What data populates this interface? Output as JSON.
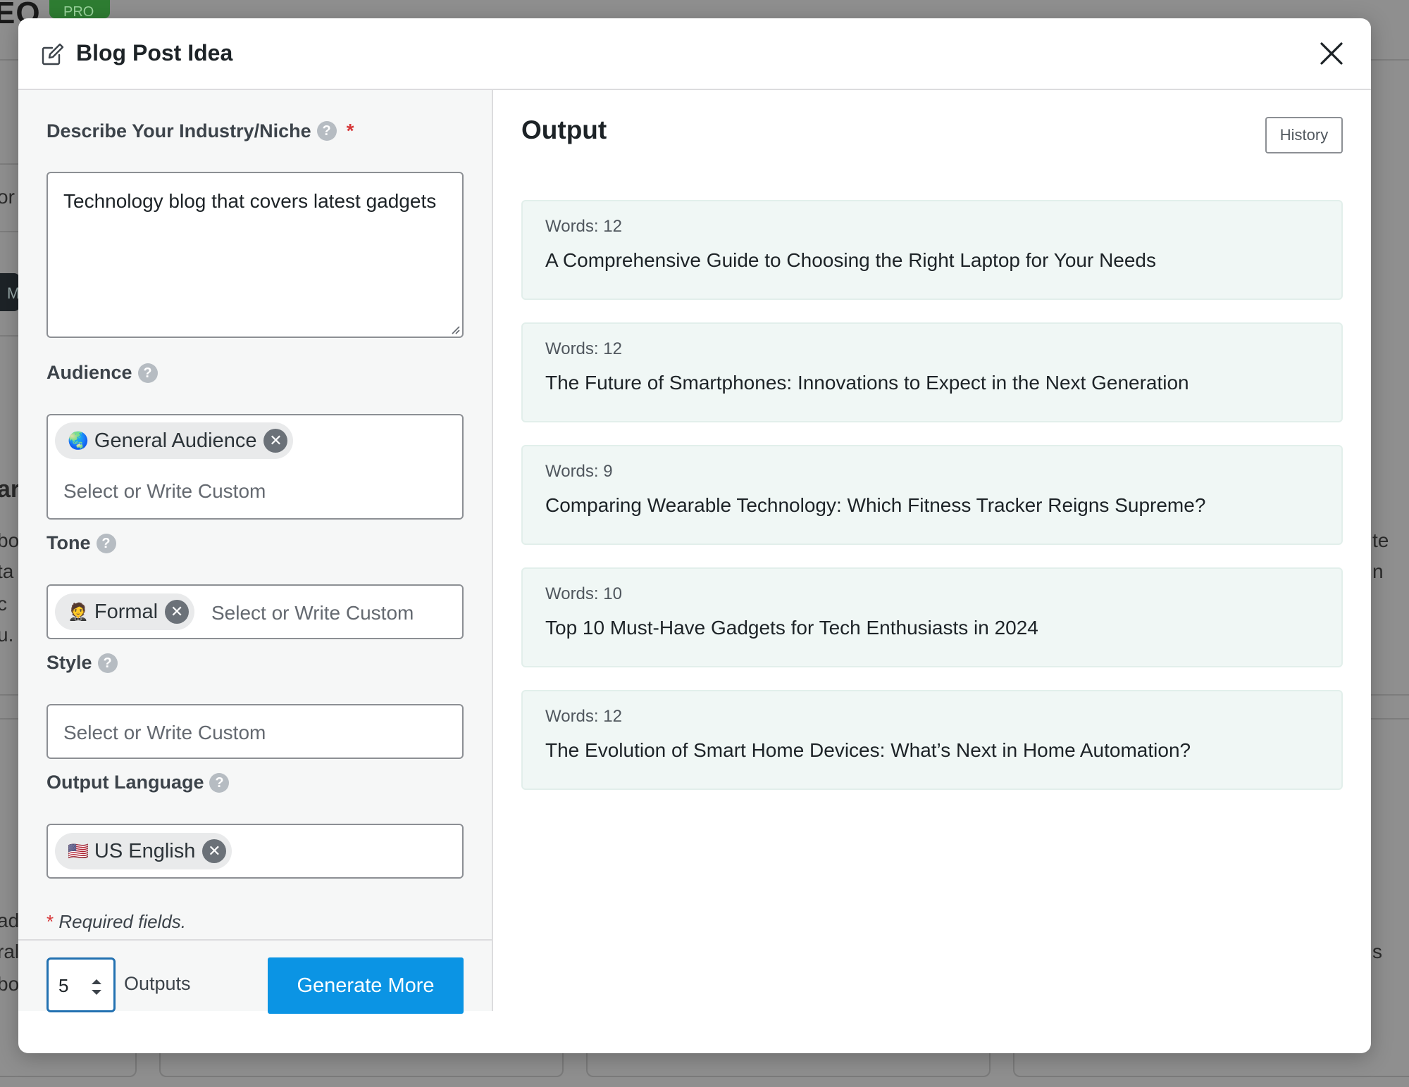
{
  "background": {
    "logo_text": "EO",
    "pro_badge": "PRO",
    "fragments": [
      "or",
      "M",
      "ar",
      "bo",
      "ta",
      "c",
      "u.",
      "te",
      "n",
      "ad",
      "ral",
      "bo",
      "s"
    ]
  },
  "modal": {
    "title": "Blog Post Idea",
    "header_icon": "edit-icon",
    "close_icon": "close-icon"
  },
  "form": {
    "industry": {
      "label": "Describe Your Industry/Niche",
      "required_mark": "*",
      "value": "Technology blog that covers latest gadgets"
    },
    "audience": {
      "label": "Audience",
      "chips": [
        {
          "emoji": "🌏",
          "label": "General Audience"
        }
      ],
      "placeholder": "Select or Write Custom"
    },
    "tone": {
      "label": "Tone",
      "chips": [
        {
          "emoji": "🤵",
          "label": "Formal"
        }
      ],
      "placeholder": "Select or Write Custom"
    },
    "style": {
      "label": "Style",
      "placeholder": "Select or Write Custom"
    },
    "language": {
      "label": "Output Language",
      "chips": [
        {
          "emoji": "🇺🇸",
          "label": "US English"
        }
      ]
    },
    "required_note_star": "*",
    "required_note": "Required fields."
  },
  "footer": {
    "outputs_value": "5",
    "outputs_label": "Outputs",
    "generate_label": "Generate More"
  },
  "output": {
    "heading": "Output",
    "history_label": "History",
    "results": [
      {
        "words": "Words: 12",
        "text": "A Comprehensive Guide to Choosing the Right Laptop for Your Needs"
      },
      {
        "words": "Words: 12",
        "text": "The Future of Smartphones: Innovations to Expect in the Next Generation"
      },
      {
        "words": "Words: 9",
        "text": "Comparing Wearable Technology: Which Fitness Tracker Reigns Supreme?"
      },
      {
        "words": "Words: 10",
        "text": "Top 10 Must-Have Gadgets for Tech Enthusiasts in 2024"
      },
      {
        "words": "Words: 12",
        "text": "The Evolution of Smart Home Devices: What’s Next in Home Automation?"
      }
    ]
  },
  "colors": {
    "accent": "#0b94e4",
    "card_bg": "#f0f7f5",
    "required": "#d63638",
    "overlay": "#8f8f8f"
  }
}
